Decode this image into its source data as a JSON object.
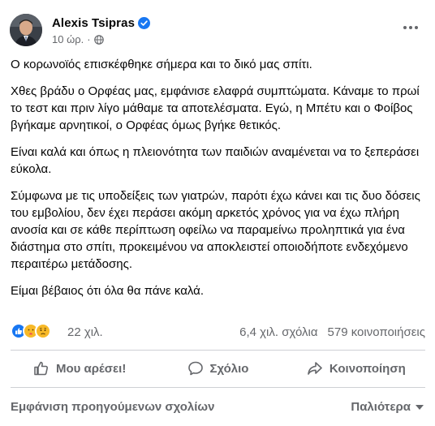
{
  "post": {
    "author": "Alexis Tsipras",
    "time": "10 ώρ.",
    "paragraphs": [
      "Ο κορωνοϊός επισκέφθηκε σήμερα και το δικό μας σπίτι.",
      "Χθες βράδυ ο Ορφέας μας, εμφάνισε ελαφρά συμπτώματα. Κάναμε το πρωί το τεστ και πριν λίγο μάθαμε τα αποτελέσματα. Εγώ, η Μπέτυ και ο Φοίβος βγήκαμε αρνητικοί, ο Ορφέας όμως βγήκε θετικός.",
      "Είναι καλά και όπως η πλειονότητα των παιδιών αναμένεται να το ξεπεράσει εύκολα.",
      "Σύμφωνα με τις υποδείξεις των γιατρών, παρότι έχω κάνει και τις δυο δόσεις του εμβολίου, δεν έχει περάσει ακόμη αρκετός χρόνος για να έχω πλήρη ανοσία και σε κάθε περίπτωση οφείλω να παραμείνω προληπτικά για ένα διάστημα στο σπίτι, προκειμένου να αποκλειστεί οποιοδήποτε ενδεχόμενο περαιτέρω μετάδοσης.",
      "Είμαι βέβαιος ότι όλα θα πάνε καλά."
    ]
  },
  "stats": {
    "reactions_count": "22 χιλ.",
    "comments": "6,4 χιλ. σχόλια",
    "shares": "579 κοινοποιήσεις"
  },
  "actions": {
    "like": "Μου αρέσει!",
    "comment": "Σχόλιο",
    "share": "Κοινοποίηση"
  },
  "comments_bar": {
    "previous": "Εμφάνιση προηγούμενων σχολίων",
    "sort": "Παλιότερα"
  },
  "colors": {
    "accent": "#1877f2",
    "secondary_text": "#65676b",
    "divider": "#ced0d4"
  },
  "icons": [
    "verified-badge-icon",
    "globe-icon",
    "more-options-icon",
    "like-reaction-icon",
    "care-reaction-icon",
    "sad-reaction-icon",
    "thumb-up-icon",
    "comment-icon",
    "share-icon",
    "caret-down-icon"
  ]
}
